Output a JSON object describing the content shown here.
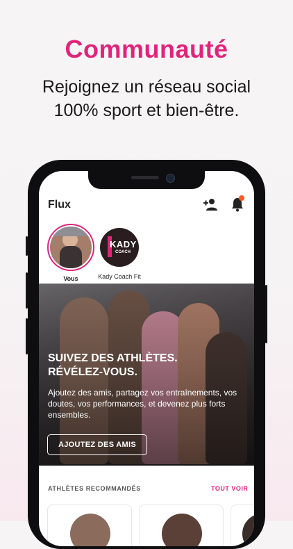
{
  "promo": {
    "headline": "Communauté",
    "subline_1": "Rejoignez un réseau social",
    "subline_2": "100% sport et bien-être."
  },
  "app": {
    "title": "Flux",
    "stories": [
      {
        "label": "Vous"
      },
      {
        "label": "Kady Coach Fit",
        "logo_line1": "KADY",
        "logo_line2": "COACH"
      }
    ],
    "hero": {
      "title_line1": "SUIVEZ DES ATHLÈTES.",
      "title_line2": "RÉVÉLEZ-VOUS.",
      "text": "Ajoutez des amis, partagez vos entraînements, vos doutes, vos performances, et devenez plus forts ensembles.",
      "button_label": "AJOUTEZ DES AMIS"
    },
    "recommended": {
      "label": "ATHLÈTES RECOMMANDÉS",
      "see_all": "TOUT VOIR"
    },
    "colors": {
      "accent": "#e1247b",
      "notification": "#ff5a1f"
    },
    "icons": [
      "add-user-icon",
      "bell-icon"
    ]
  }
}
